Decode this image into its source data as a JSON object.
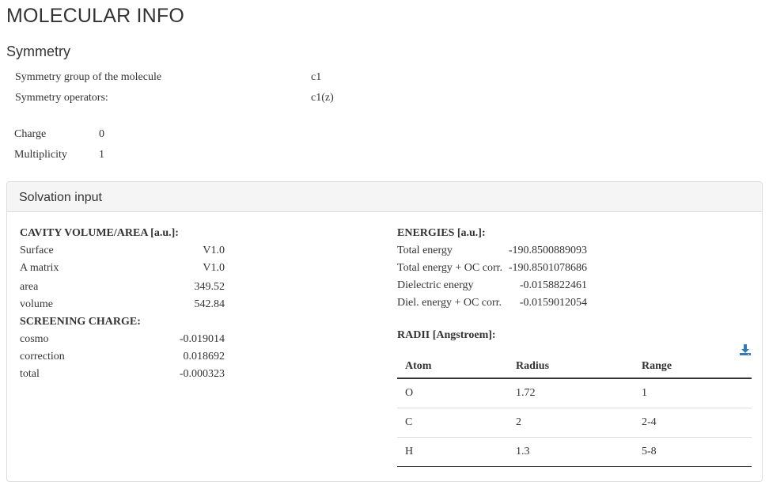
{
  "page": {
    "title": "MOLECULAR INFO"
  },
  "symmetry": {
    "heading": "Symmetry",
    "rows": [
      {
        "label": "Symmetry group of the molecule",
        "value": "c1"
      },
      {
        "label": "Symmetry operators:",
        "value": "c1(z)"
      }
    ],
    "charge": {
      "label": "Charge",
      "value": "0"
    },
    "multiplicity": {
      "label": "Multiplicity",
      "value": "1"
    }
  },
  "solvation": {
    "panel_title": "Solvation input",
    "cavity": {
      "heading": "CAVITY VOLUME/AREA [a.u.]:",
      "rows": [
        {
          "label": "Surface",
          "value": "V1.0"
        },
        {
          "label": "A matrix",
          "value": "V1.0"
        },
        {
          "label": "area",
          "value": "349.52"
        },
        {
          "label": "volume",
          "value": "542.84"
        }
      ]
    },
    "screening": {
      "heading": "SCREENING CHARGE:",
      "rows": [
        {
          "label": "cosmo",
          "value": "-0.019014"
        },
        {
          "label": "correction",
          "value": "0.018692"
        },
        {
          "label": "total",
          "value": "-0.000323"
        }
      ]
    },
    "energies": {
      "heading": "ENERGIES [a.u.]:",
      "rows": [
        {
          "label": "Total energy",
          "value": "-190.8500889093"
        },
        {
          "label": "Total energy + OC corr.",
          "value": "-190.8501078686"
        },
        {
          "label": "Dielectric energy",
          "value": "-0.0158822461"
        },
        {
          "label": "Diel. energy + OC corr.",
          "value": "-0.0159012054"
        }
      ]
    },
    "radii": {
      "heading": "RADII [Angstroem]:",
      "download_icon": "download-icon",
      "columns": [
        "Atom",
        "Radius",
        "Range"
      ],
      "rows": [
        [
          "O",
          "1.72",
          "1"
        ],
        [
          "C",
          "2",
          "2-4"
        ],
        [
          "H",
          "1.3",
          "5-8"
        ]
      ]
    }
  },
  "colors": {
    "accent": "#337ab7",
    "panel_header": "#f5f5f5",
    "border": "#dddddd",
    "text": "#333333"
  }
}
